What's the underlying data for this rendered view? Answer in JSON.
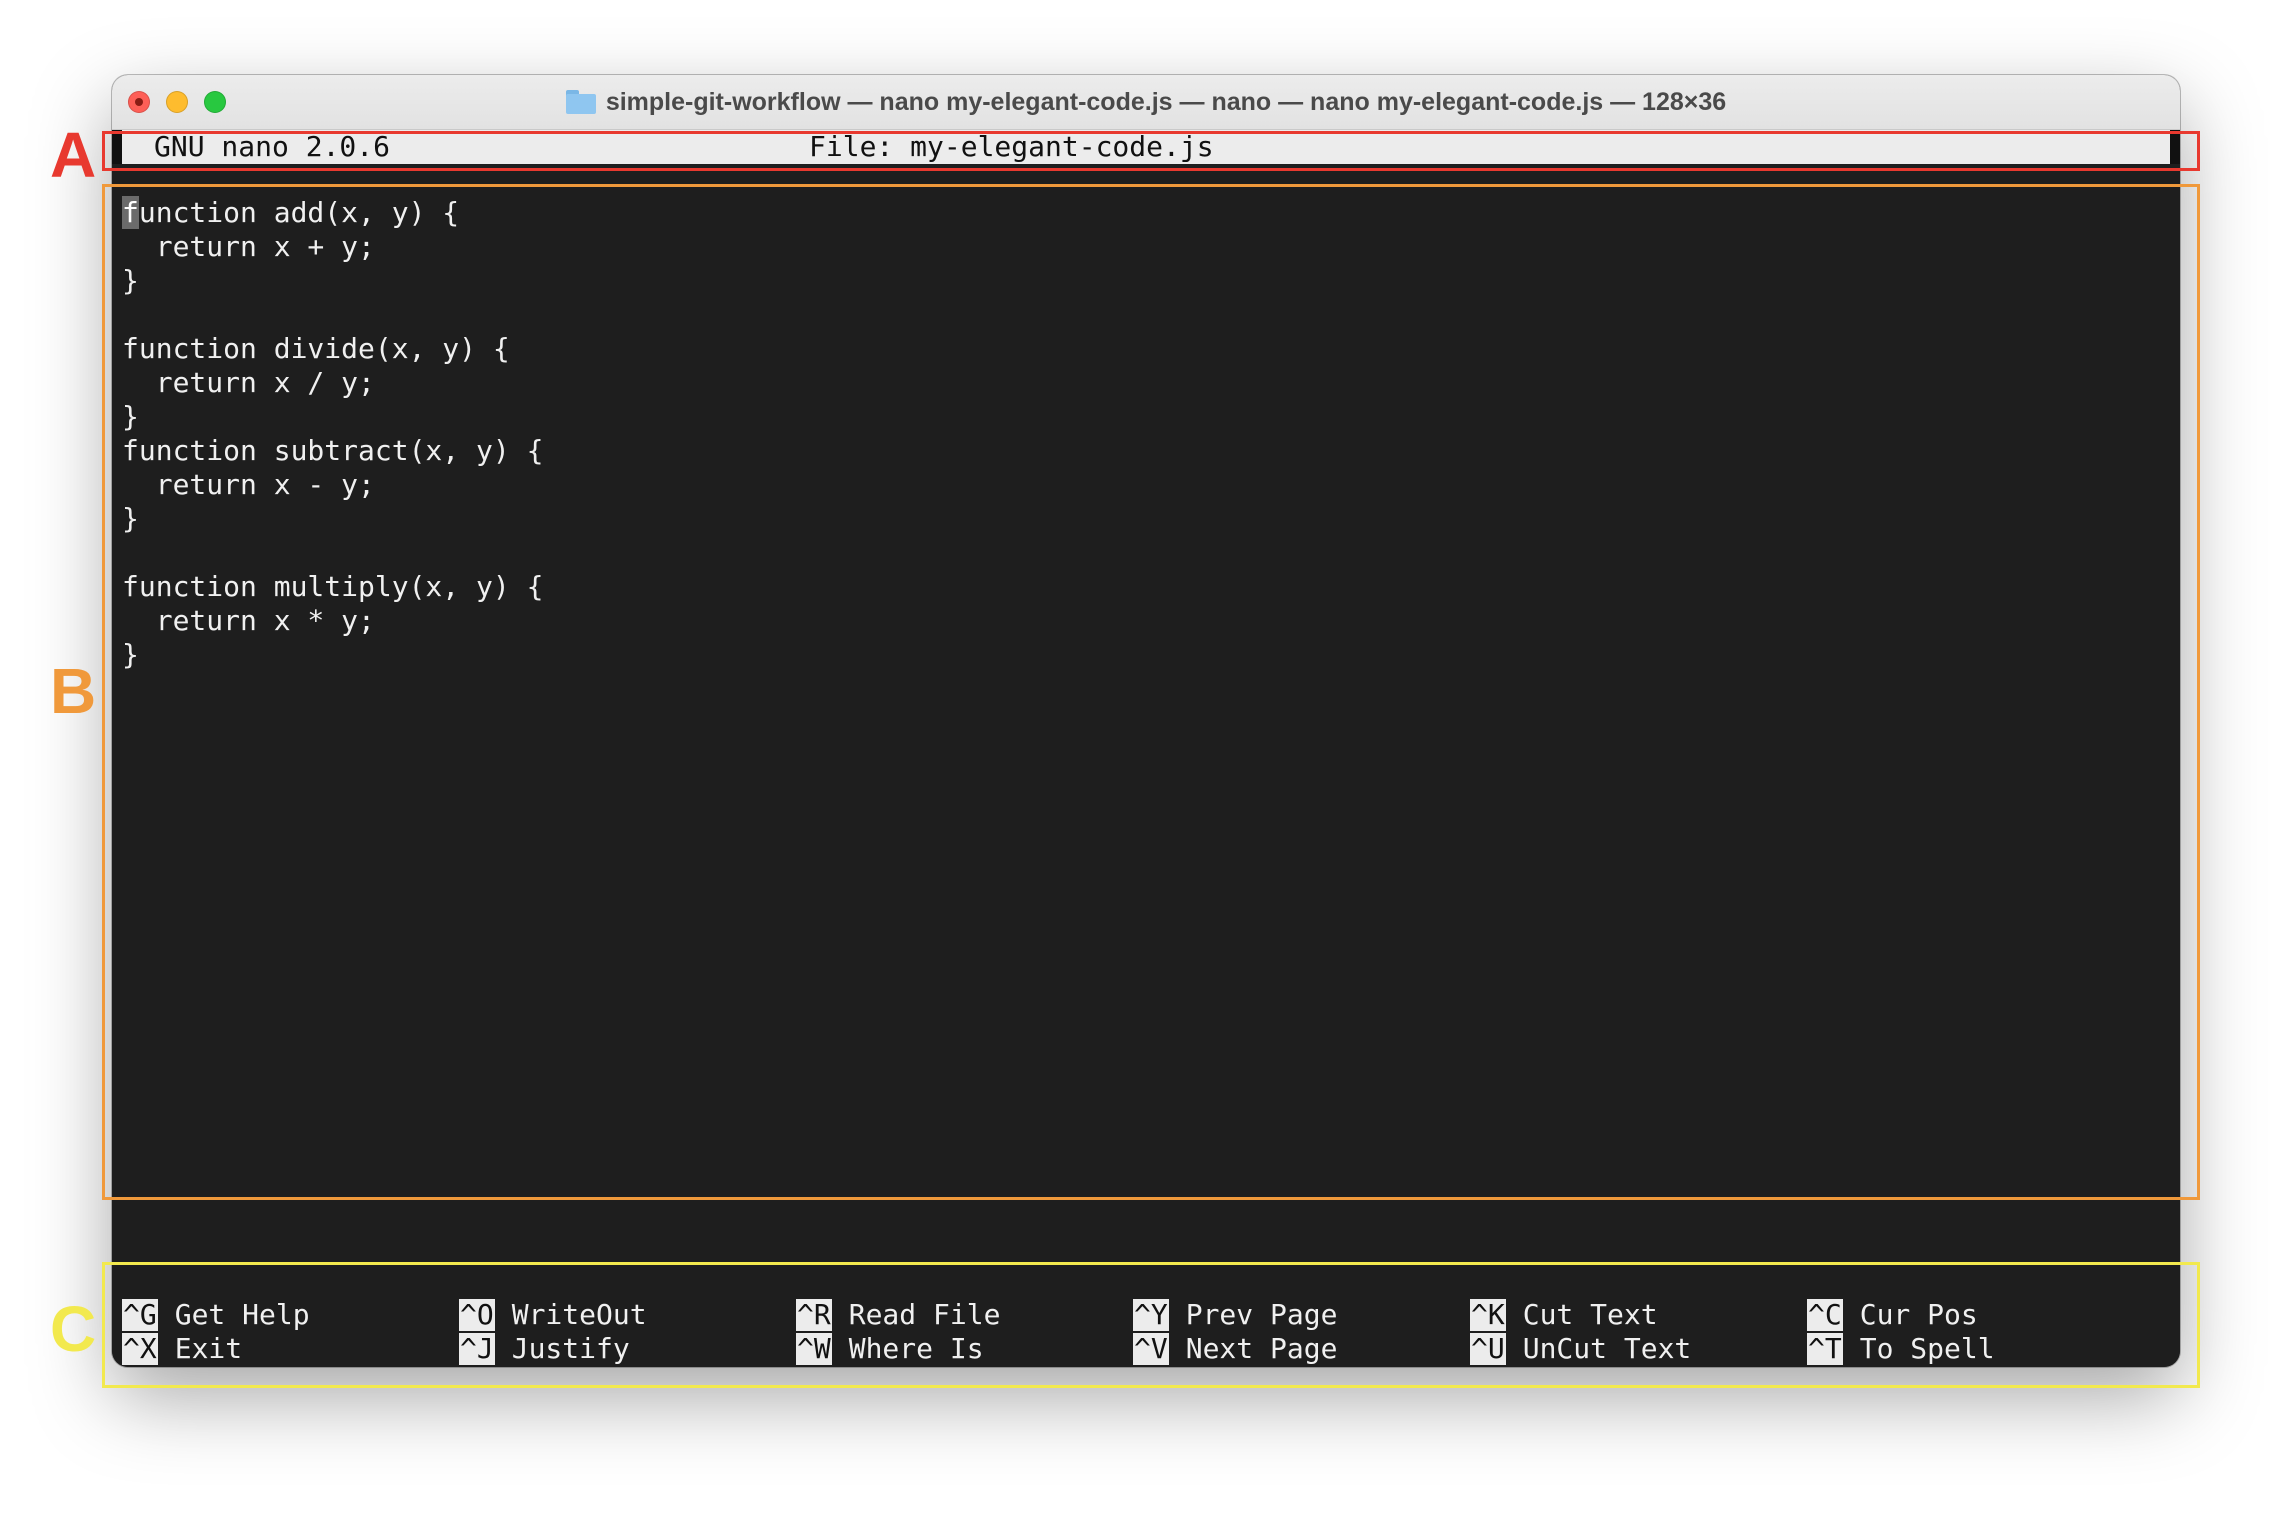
{
  "window": {
    "title": "simple-git-workflow — nano my-elegant-code.js — nano — nano my-elegant-code.js — 128×36"
  },
  "nano": {
    "version": "GNU nano 2.0.6",
    "file_label": "File: my-elegant-code.js"
  },
  "code": {
    "first_line_cursor_char": "f",
    "first_line_rest": "unction add(x, y) {",
    "lines": [
      "",
      "  return x + y;",
      "}",
      "",
      "function divide(x, y) {",
      "  return x / y;",
      "}",
      "function subtract(x, y) {",
      "  return x - y;",
      "}",
      "",
      "function multiply(x, y) {",
      "  return x * y;",
      "}"
    ]
  },
  "shortcuts": [
    {
      "key": "^G",
      "label": "Get Help"
    },
    {
      "key": "^X",
      "label": "Exit"
    },
    {
      "key": "^O",
      "label": "WriteOut"
    },
    {
      "key": "^J",
      "label": "Justify"
    },
    {
      "key": "^R",
      "label": "Read File"
    },
    {
      "key": "^W",
      "label": "Where Is"
    },
    {
      "key": "^Y",
      "label": "Prev Page"
    },
    {
      "key": "^V",
      "label": "Next Page"
    },
    {
      "key": "^K",
      "label": "Cut Text"
    },
    {
      "key": "^U",
      "label": "UnCut Text"
    },
    {
      "key": "^C",
      "label": "Cur Pos"
    },
    {
      "key": "^T",
      "label": "To Spell"
    }
  ],
  "annotations": {
    "a": {
      "letter": "A",
      "color": "#e8392f"
    },
    "b": {
      "letter": "B",
      "color": "#f0993b"
    },
    "c": {
      "letter": "C",
      "color": "#f2e94e"
    }
  },
  "icons": {
    "title_folder": "folder-icon"
  }
}
